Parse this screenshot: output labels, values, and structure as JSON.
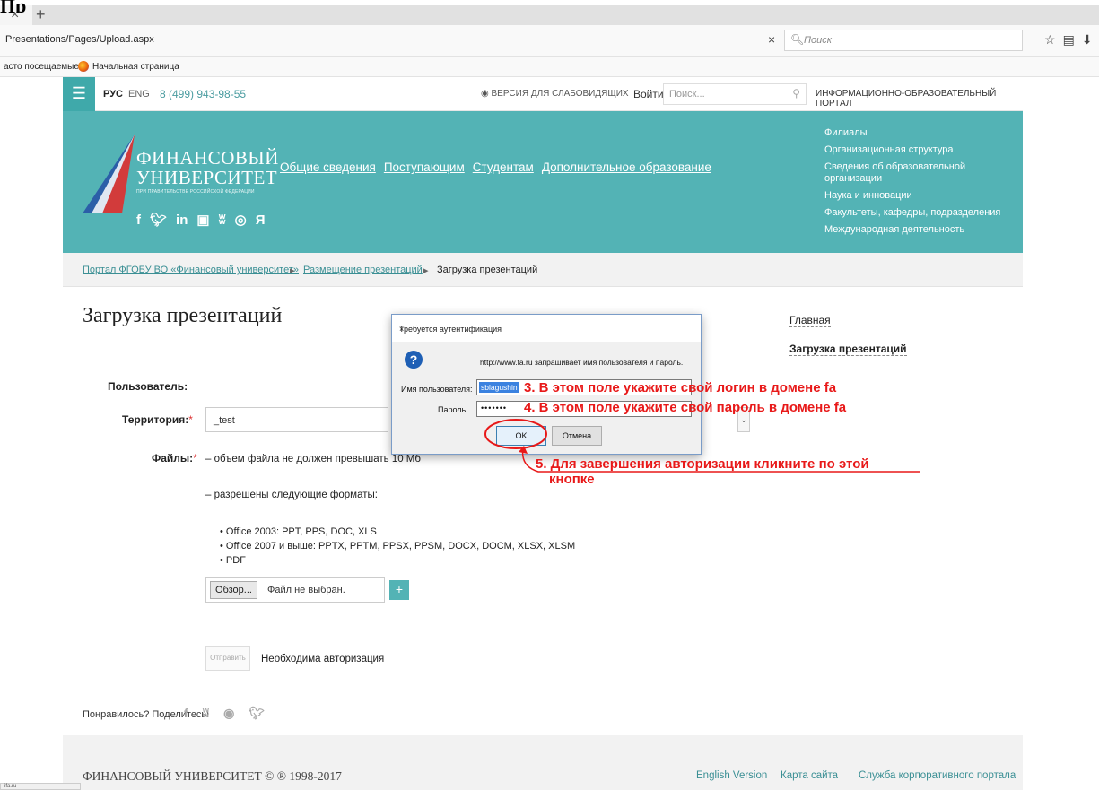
{
  "browser": {
    "cover_text": "Пр",
    "tab_close": "×",
    "tab_new": "+",
    "url": "Presentations/Pages/Upload.aspx",
    "url_clear": "×",
    "search_placeholder": "Поиск",
    "bookmarks": [
      "асто посещаемые",
      "Начальная страница"
    ],
    "status_text": "ifa.ru"
  },
  "site": {
    "lang_ru": "РУС",
    "lang_en": "ENG",
    "phone": "8 (499) 943-98-55",
    "accessibility": "ВЕРСИЯ ДЛЯ СЛАБОВИДЯЩИХ",
    "login": "Войти",
    "search_placeholder": "Поиск...",
    "portal_label": "ИНФОРМАЦИОННО-ОБРАЗОВАТЕЛЬНЫЙ ПОРТАЛ",
    "logo": {
      "line1": "ФИНАНСОВЫЙ",
      "line2": "УНИВЕРСИТЕТ",
      "line3": "ПРИ ПРАВИТЕЛЬСТВЕ РОССИЙСКОЙ ФЕДЕРАЦИИ"
    },
    "socials": [
      "f",
      "y",
      "in",
      "You",
      "vk",
      "ig",
      "Я"
    ],
    "main_nav": [
      "Общие сведения",
      "Поступающим",
      "Студентам",
      "Дополнительное образование"
    ],
    "side_nav": [
      "Филиалы",
      "Организационная структура",
      "Сведения об образовательной организации",
      "Наука и инновации",
      "Факультеты, кафедры, подразделения",
      "Международная деятельность"
    ],
    "breadcrumbs": [
      "Портал ФГОБУ ВО «Финансовый университет»",
      "Размещение презентаций",
      "Загрузка презентаций"
    ]
  },
  "form": {
    "title": "Загрузка презентаций",
    "user_label": "Пользователь:",
    "territory_label": "Территория:",
    "territory_value": "_test",
    "files_label": "Файлы:",
    "required_mark": "*",
    "note_size": "– объем файла не должен превышать 10 Мб",
    "note_formats": "– разрешены следующие форматы:",
    "formats": [
      "Office 2003: PPT, PPS, DOC, XLS",
      "Office 2007 и выше: PPTX, PPTM, PPSX, PPSM, DOCX, DOCM, XLSX, XLSM",
      "PDF"
    ],
    "browse_button": "Обзор...",
    "no_file": "Файл не выбран.",
    "add_button": "+",
    "send_button": "Отправить",
    "auth_required": "Необходима авторизация"
  },
  "right_nav": {
    "home": "Главная",
    "upload": "Загрузка презентаций"
  },
  "share": {
    "label": "Понравилось? Поделитесь!"
  },
  "footer": {
    "copyright": "ФИНАНСОВЫЙ УНИВЕРСИТЕТ © ® 1998-2017",
    "links": [
      "English Version",
      "Карта сайта",
      "Служба корпоративного портала"
    ]
  },
  "dialog": {
    "title": "Требуется аутентификация",
    "close": "×",
    "message": "http://www.fa.ru запрашивает имя пользователя и пароль.",
    "username_label": "Имя пользователя:",
    "username_value": "sblagushin",
    "password_label": "Пароль:",
    "password_value": "•••••••",
    "ok": "OK",
    "cancel": "Отмена"
  },
  "annotations": {
    "step3": "3. В этом поле укажите свой логин в домене fa",
    "step4": "4. В этом поле укажите свой пароль в домене fa",
    "step5_line1": "5. Для завершения авторизации кликните по этой",
    "step5_line2": "кнопке"
  },
  "colors": {
    "brand_teal": "#53b3b5",
    "annotation_red": "#e81919"
  }
}
